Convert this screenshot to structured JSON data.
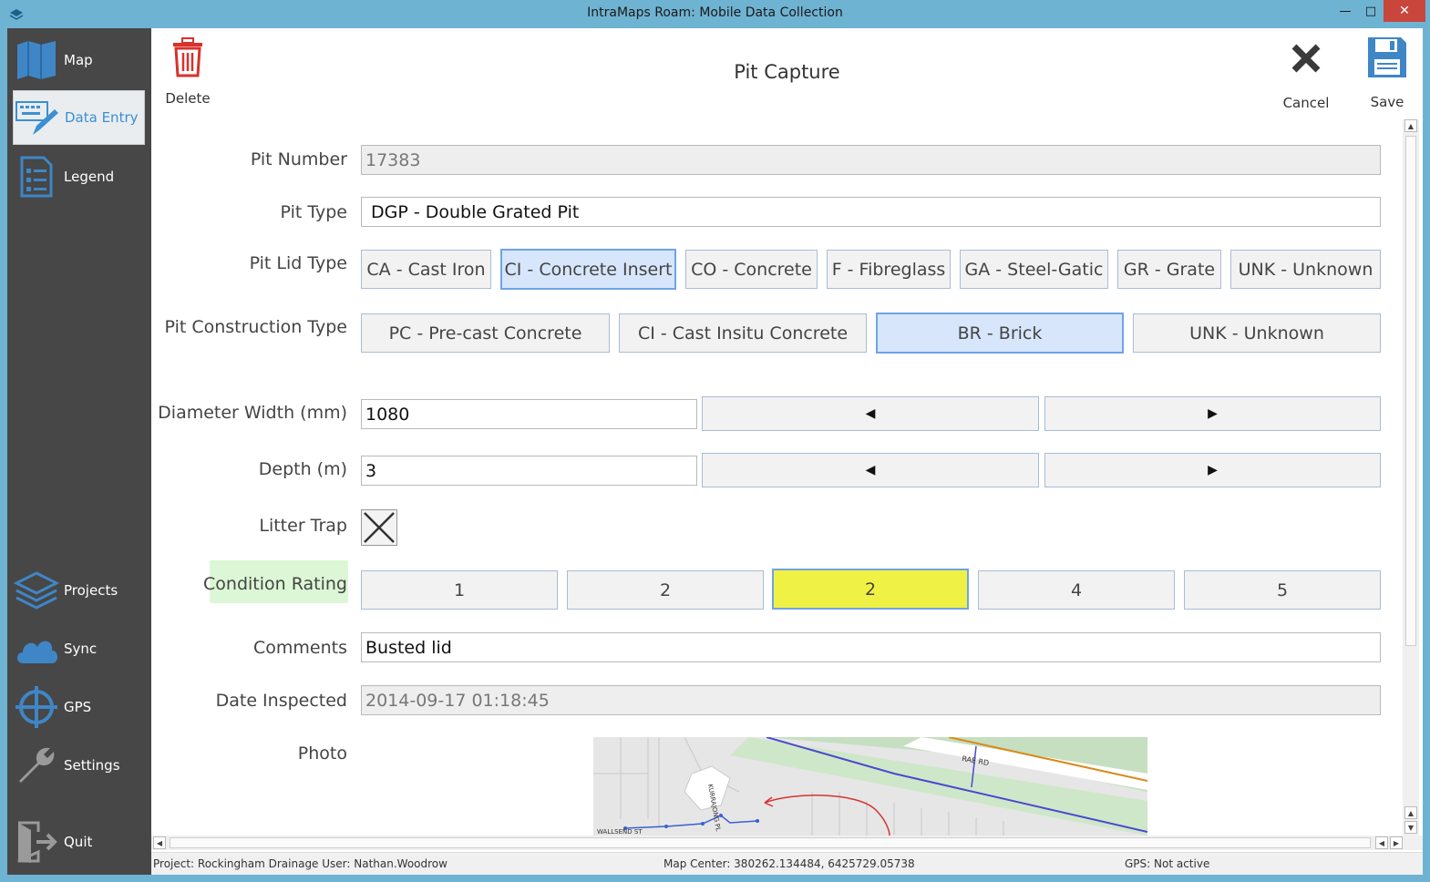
{
  "window": {
    "title": "IntraMaps Roam: Mobile Data Collection",
    "min_symbol": "—",
    "max_symbol": "□",
    "close_symbol": "✕"
  },
  "sidebar": {
    "items": [
      {
        "label": "Map",
        "icon": "map-icon"
      },
      {
        "label": "Data Entry",
        "icon": "keyboard-pencil-icon",
        "active": true
      },
      {
        "label": "Legend",
        "icon": "legend-icon"
      },
      {
        "label": "Projects",
        "icon": "layers-icon"
      },
      {
        "label": "Sync",
        "icon": "cloud-icon"
      },
      {
        "label": "GPS",
        "icon": "crosshair-icon"
      },
      {
        "label": "Settings",
        "icon": "wrench-icon"
      },
      {
        "label": "Quit",
        "icon": "exit-door-icon"
      }
    ]
  },
  "toolbar": {
    "delete_label": "Delete",
    "title": "Pit Capture",
    "cancel_label": "Cancel",
    "save_label": "Save"
  },
  "form": {
    "pit_number": {
      "label": "Pit Number",
      "value": "17383"
    },
    "pit_type": {
      "label": "Pit Type",
      "value": "DGP - Double Grated Pit"
    },
    "pit_lid_type": {
      "label": "Pit Lid Type",
      "options": [
        "CA - Cast Iron",
        "CI - Concrete Insert",
        "CO - Concrete",
        "F - Fibreglass",
        "GA - Steel-Gatic",
        "GR - Grate",
        "UNK - Unknown"
      ],
      "selected": "CI - Concrete Insert"
    },
    "pit_construction_type": {
      "label": "Pit Construction Type",
      "options": [
        "PC - Pre-cast Concrete",
        "CI - Cast Insitu Concrete",
        "BR - Brick",
        "UNK - Unknown"
      ],
      "selected": "BR - Brick"
    },
    "diameter_width": {
      "label": "Diameter Width (mm)",
      "value": "1080"
    },
    "depth": {
      "label": "Depth (m)",
      "value": "3"
    },
    "litter_trap": {
      "label": "Litter Trap",
      "checked": true
    },
    "condition_rating": {
      "label": "Condition Rating",
      "options": [
        "1",
        "2",
        "2",
        "4",
        "5"
      ],
      "selected_index": 2
    },
    "comments": {
      "label": "Comments",
      "value": "Busted lid"
    },
    "date_inspected": {
      "label": "Date Inspected",
      "value": "2014-09-17 01:18:45"
    },
    "photo": {
      "label": "Photo",
      "map_labels": [
        "RAE RD",
        "KURRAJONG PL",
        "WALLSEND ST"
      ]
    }
  },
  "status": {
    "project_user": "Project: Rockingham Drainage  User: Nathan.Woodrow",
    "map_center": "Map Center: 380262.134484, 6425729.05738",
    "gps": "GPS: Not active"
  },
  "colors": {
    "titlebar": "#6fb3d2",
    "sidebar": "#474747",
    "accent": "#3d8fd1",
    "selected_option": "#d7e6fb",
    "condition_highlight": "#eff245",
    "condition_label_bg": "#dcf7d5",
    "delete_red": "#d9312b"
  }
}
